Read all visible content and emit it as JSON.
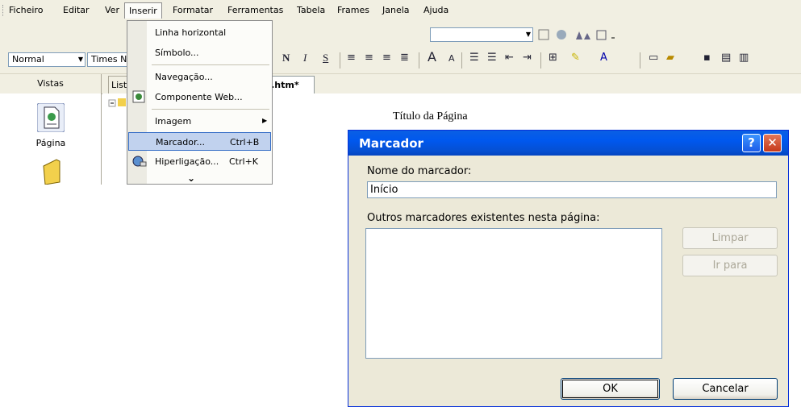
{
  "menubar": {
    "items": [
      "Ficheiro",
      "Editar",
      "Ver",
      "Inserir",
      "Formatar",
      "Ferramentas",
      "Tabela",
      "Frames",
      "Janela",
      "Ajuda"
    ]
  },
  "toolbar": {
    "style_value": "Normal",
    "font_value": "Times New"
  },
  "views_pane": {
    "header": "Vistas",
    "page_label": "Página"
  },
  "folder_list": {
    "tab_label": "Lista"
  },
  "editor": {
    "file_tab": "x.htm*",
    "page_heading": "Título da Página"
  },
  "insert_menu": {
    "items": [
      {
        "label": "Linha horizontal",
        "shortcut": ""
      },
      {
        "label": "Símbolo...",
        "shortcut": ""
      },
      {
        "label": "Navegação...",
        "shortcut": ""
      },
      {
        "label": "Componente Web...",
        "shortcut": ""
      },
      {
        "label": "Imagem",
        "shortcut": ""
      },
      {
        "label": "Marcador...",
        "shortcut": "Ctrl+B"
      },
      {
        "label": "Hiperligação...",
        "shortcut": "Ctrl+K"
      }
    ],
    "expand_glyph": "⌄"
  },
  "dialog": {
    "title": "Marcador",
    "help_glyph": "?",
    "close_glyph": "✕",
    "name_label": "Nome do marcador:",
    "name_value": "Início",
    "other_label": "Outros marcadores existentes nesta página:",
    "clear_button": "Limpar",
    "goto_button": "Ir para",
    "ok_button": "OK",
    "cancel_button": "Cancelar"
  },
  "colors": {
    "title_bar": "#0058ee",
    "menu_highlight": "#c1d2ee",
    "dialog_bg": "#ece9d8",
    "toolbar_bg": "#f1efe2"
  },
  "icons": [
    "page-view-icon",
    "folder-view-icon",
    "help-icon",
    "close-icon",
    "bold-icon",
    "italic-icon",
    "underline-icon",
    "align-left-icon",
    "center-icon",
    "align-right-icon",
    "justify-icon",
    "grow-font-icon",
    "shrink-font-icon",
    "numbered-list-icon",
    "bullet-list-icon",
    "indent-icon",
    "outdent-icon",
    "border-icon",
    "highlight-icon",
    "font-color-icon",
    "new-page-icon",
    "open-icon",
    "save-icon"
  ]
}
